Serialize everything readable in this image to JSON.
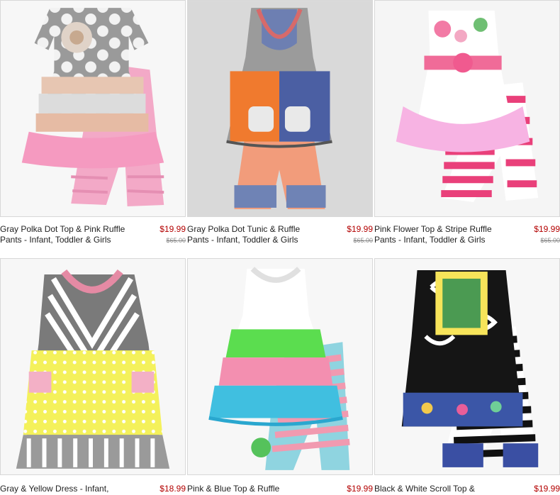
{
  "products": [
    {
      "title": "Gray Polka Dot Top & Pink Ruffle Pants - Infant, Toddler & Girls",
      "price": "$19.99",
      "original_price": "$65.00"
    },
    {
      "title": "Gray Polka Dot Tunic & Ruffle Pants - Infant, Toddler & Girls",
      "price": "$19.99",
      "original_price": "$65.00"
    },
    {
      "title": "Pink Flower Top & Stripe Ruffle Pants - Infant, Toddler & Girls",
      "price": "$19.99",
      "original_price": "$65.00"
    },
    {
      "title": "Gray & Yellow Dress - Infant,",
      "price": "$18.99"
    },
    {
      "title": "Pink & Blue Top & Ruffle",
      "price": "$19.99"
    },
    {
      "title": "Black & White Scroll Top &",
      "price": "$19.99"
    }
  ],
  "colors": {
    "price": "#b30000",
    "original_price": "#8a8a8a",
    "title": "#222222",
    "border": "#d8d8d8"
  }
}
